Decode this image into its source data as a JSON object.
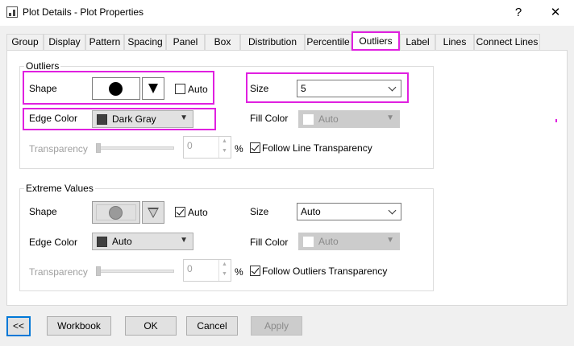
{
  "window": {
    "title": "Plot Details - Plot Properties",
    "help_label": "?",
    "close_label": "✕"
  },
  "tabs": [
    {
      "label": "Group"
    },
    {
      "label": "Display"
    },
    {
      "label": "Pattern"
    },
    {
      "label": "Spacing"
    },
    {
      "label": "Panel"
    },
    {
      "label": "Box"
    },
    {
      "label": "Distribution"
    },
    {
      "label": "Percentile"
    },
    {
      "label": "Outliers",
      "active": true
    },
    {
      "label": "Label"
    },
    {
      "label": "Lines"
    },
    {
      "label": "Connect Lines"
    }
  ],
  "outliers": {
    "group_title": "Outliers",
    "shape_label": "Shape",
    "auto_label": "Auto",
    "auto_checked": false,
    "size_label": "Size",
    "size_value": "5",
    "edge_color_label": "Edge Color",
    "edge_color_value": "Dark Gray",
    "edge_color_hex": "#404040",
    "fill_color_label": "Fill Color",
    "fill_color_value": "Auto",
    "transparency_label": "Transparency",
    "transparency_value": "0",
    "percent": "%",
    "follow_label": "Follow Line Transparency",
    "follow_checked": true
  },
  "extreme": {
    "group_title": "Extreme Values",
    "shape_label": "Shape",
    "auto_label": "Auto",
    "auto_checked": true,
    "size_label": "Size",
    "size_value": "Auto",
    "edge_color_label": "Edge Color",
    "edge_color_value": "Auto",
    "edge_color_hex": "#404040",
    "fill_color_label": "Fill Color",
    "fill_color_value": "Auto",
    "transparency_label": "Transparency",
    "transparency_value": "0",
    "percent": "%",
    "follow_label": "Follow Outliers Transparency",
    "follow_checked": true
  },
  "footer": {
    "collapse_label": "<<",
    "workbook_label": "Workbook",
    "ok_label": "OK",
    "cancel_label": "Cancel",
    "apply_label": "Apply"
  },
  "colors": {
    "highlight": "#e020e0",
    "focus": "#0078d7"
  }
}
